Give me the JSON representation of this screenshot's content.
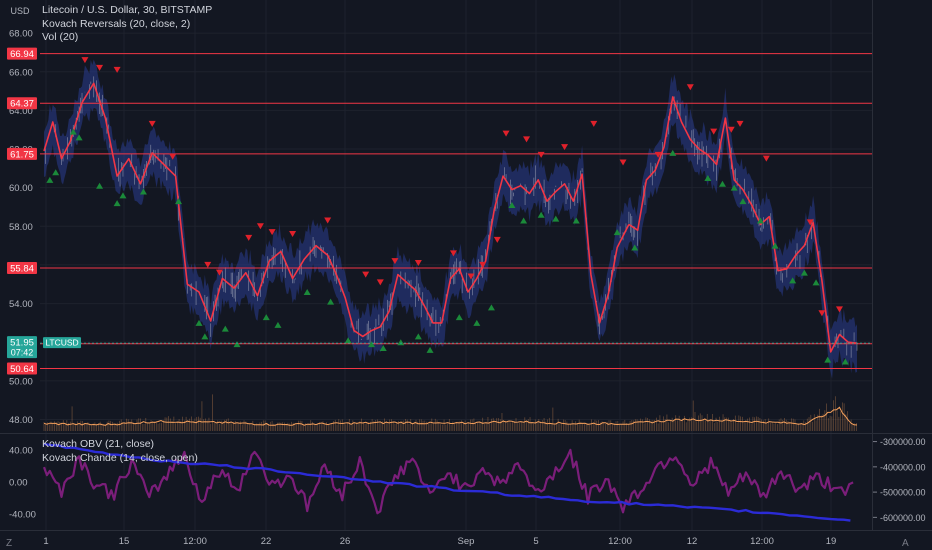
{
  "header": {
    "currency": "USD",
    "symbol_line": "Litecoin / U.S. Dollar, 30, BITSTAMP",
    "indicator1": "Kovach Reversals (20, close, 2)",
    "indicator2": "Vol (20)"
  },
  "lower_pane": {
    "indicator1": "Kovach OBV (21, close)",
    "indicator2": "Kovach Chande (14, close, open)"
  },
  "footer": {
    "left_button": "Z",
    "right_button": "A"
  },
  "colors": {
    "background": "#131722",
    "grid": "#1e222d",
    "level_line": "#f23645",
    "price": "#f23645",
    "band": "#2a3d8f",
    "volume": "#f7a15c",
    "obv": "#2b2bd6",
    "chande": "#7b1e7a",
    "buy_marker": "#1b8a3a",
    "sell_marker": "#e0212b",
    "last_price": "#26a69a"
  },
  "chart_data": [
    {
      "type": "line",
      "title": "Litecoin / U.S. Dollar, 30, BITSTAMP",
      "ylabel": "USD",
      "ylim": [
        47.3,
        69.3
      ],
      "y_ticks": [
        "48.00",
        "50.00",
        "52.00",
        "54.00",
        "56.00",
        "58.00",
        "60.00",
        "62.00",
        "64.00",
        "66.00",
        "68.00"
      ],
      "x_ticks": [
        "1",
        "15",
        "12:00",
        "22",
        "26",
        "Sep",
        "5",
        "12:00",
        "12",
        "12:00",
        "19"
      ],
      "horizontal_levels": [
        "66.94",
        "64.37",
        "61.75",
        "55.84",
        "51.92",
        "50.64"
      ],
      "last_price": {
        "symbol": "LTCUSD",
        "value": "51.95",
        "countdown": "07:42"
      },
      "series": [
        {
          "x": [
            0,
            3,
            6,
            9,
            13,
            17,
            21,
            25,
            29,
            33,
            37,
            41,
            45,
            49,
            53,
            57,
            61,
            65,
            69,
            73,
            77,
            81,
            85,
            89,
            93,
            97,
            100
          ],
          "values": [
            61.9,
            63.4,
            61.5,
            62.4,
            64.4,
            65.4,
            63.6,
            60.6,
            61.5,
            60.2,
            61.8,
            61.2,
            60.6,
            55.0,
            54.6,
            53.1,
            55.3,
            54.8,
            55.6,
            54.4,
            56.2,
            56.7,
            55.3,
            56.3,
            57.0,
            56.5,
            55.5
          ]
        },
        {
          "x": [
            100,
            103,
            106,
            109,
            112,
            115,
            118,
            121,
            124,
            127,
            130,
            133,
            136,
            139,
            142,
            145,
            148,
            151,
            154,
            157,
            160,
            163,
            166,
            169,
            172,
            175,
            178,
            181,
            184,
            187,
            190,
            193,
            196,
            200
          ],
          "values": [
            55.5,
            54.3,
            52.6,
            52.3,
            52.6,
            52.8,
            53.6,
            55.5,
            55.1,
            54.7,
            53.9,
            53.0,
            53.0,
            55.3,
            55.8,
            54.6,
            55.3,
            56.2,
            58.9,
            60.6,
            59.9,
            60.1,
            59.7,
            60.4,
            59.3,
            59.8,
            60.2,
            59.3,
            60.7,
            55.5,
            53.0,
            54.5,
            56.9,
            58.1
          ]
        },
        {
          "x": [
            200,
            203,
            206,
            209,
            212,
            215,
            218,
            221,
            224,
            227,
            230,
            233,
            236,
            239,
            242,
            245,
            248,
            251,
            254,
            257,
            260,
            263,
            266,
            269,
            272,
            275,
            278
          ],
          "values": [
            58.1,
            57.8,
            60.4,
            60.9,
            62.1,
            64.7,
            63.4,
            62.5,
            62.0,
            61.7,
            61.2,
            63.6,
            60.4,
            59.9,
            59.1,
            58.1,
            58.5,
            55.7,
            55.8,
            56.5,
            57.0,
            58.2,
            55.2,
            51.5,
            52.4,
            52.0,
            51.95
          ]
        }
      ],
      "buy_signals": [
        {
          "x": 2,
          "y": 60.4
        },
        {
          "x": 4,
          "y": 60.8
        },
        {
          "x": 10,
          "y": 62.9
        },
        {
          "x": 12,
          "y": 62.6
        },
        {
          "x": 19,
          "y": 60.1
        },
        {
          "x": 25,
          "y": 59.2
        },
        {
          "x": 27,
          "y": 59.6
        },
        {
          "x": 34,
          "y": 59.8
        },
        {
          "x": 46,
          "y": 59.3
        },
        {
          "x": 53,
          "y": 53.0
        },
        {
          "x": 55,
          "y": 52.3
        },
        {
          "x": 62,
          "y": 52.7
        },
        {
          "x": 66,
          "y": 51.9
        },
        {
          "x": 76,
          "y": 53.3
        },
        {
          "x": 80,
          "y": 52.9
        },
        {
          "x": 90,
          "y": 54.6
        },
        {
          "x": 98,
          "y": 54.1
        },
        {
          "x": 104,
          "y": 52.1
        },
        {
          "x": 112,
          "y": 51.9
        },
        {
          "x": 116,
          "y": 51.7
        },
        {
          "x": 122,
          "y": 52.0
        },
        {
          "x": 128,
          "y": 52.3
        },
        {
          "x": 132,
          "y": 51.6
        },
        {
          "x": 142,
          "y": 53.3
        },
        {
          "x": 148,
          "y": 53.0
        },
        {
          "x": 153,
          "y": 53.8
        },
        {
          "x": 160,
          "y": 59.1
        },
        {
          "x": 164,
          "y": 58.3
        },
        {
          "x": 170,
          "y": 58.6
        },
        {
          "x": 175,
          "y": 58.4
        },
        {
          "x": 182,
          "y": 58.3
        },
        {
          "x": 196,
          "y": 57.7
        },
        {
          "x": 202,
          "y": 56.9
        },
        {
          "x": 215,
          "y": 61.8
        },
        {
          "x": 227,
          "y": 60.5
        },
        {
          "x": 232,
          "y": 60.2
        },
        {
          "x": 236,
          "y": 60.0
        },
        {
          "x": 239,
          "y": 59.3
        },
        {
          "x": 245,
          "y": 58.3
        },
        {
          "x": 250,
          "y": 57.0
        },
        {
          "x": 256,
          "y": 55.2
        },
        {
          "x": 260,
          "y": 55.6
        },
        {
          "x": 264,
          "y": 55.1
        },
        {
          "x": 268,
          "y": 51.1
        },
        {
          "x": 274,
          "y": 51.0
        }
      ],
      "sell_signals": [
        {
          "x": 14,
          "y": 66.6
        },
        {
          "x": 19,
          "y": 66.2
        },
        {
          "x": 25,
          "y": 66.1
        },
        {
          "x": 37,
          "y": 63.3
        },
        {
          "x": 44,
          "y": 61.6
        },
        {
          "x": 56,
          "y": 56.0
        },
        {
          "x": 60,
          "y": 55.6
        },
        {
          "x": 70,
          "y": 57.4
        },
        {
          "x": 74,
          "y": 58.0
        },
        {
          "x": 78,
          "y": 57.7
        },
        {
          "x": 85,
          "y": 57.6
        },
        {
          "x": 97,
          "y": 58.3
        },
        {
          "x": 110,
          "y": 55.5
        },
        {
          "x": 115,
          "y": 55.1
        },
        {
          "x": 120,
          "y": 56.2
        },
        {
          "x": 128,
          "y": 56.1
        },
        {
          "x": 140,
          "y": 56.6
        },
        {
          "x": 146,
          "y": 55.4
        },
        {
          "x": 150,
          "y": 56.0
        },
        {
          "x": 155,
          "y": 57.3
        },
        {
          "x": 158,
          "y": 62.8
        },
        {
          "x": 165,
          "y": 62.5
        },
        {
          "x": 170,
          "y": 61.7
        },
        {
          "x": 178,
          "y": 62.1
        },
        {
          "x": 188,
          "y": 63.3
        },
        {
          "x": 198,
          "y": 61.3
        },
        {
          "x": 210,
          "y": 61.7
        },
        {
          "x": 221,
          "y": 65.2
        },
        {
          "x": 229,
          "y": 62.9
        },
        {
          "x": 235,
          "y": 63.0
        },
        {
          "x": 238,
          "y": 63.3
        },
        {
          "x": 247,
          "y": 61.5
        },
        {
          "x": 262,
          "y": 58.2
        },
        {
          "x": 266,
          "y": 53.5
        },
        {
          "x": 272,
          "y": 53.7
        }
      ]
    },
    {
      "type": "line",
      "title": "Kovach OBV (21, close) / Kovach Chande (14, close, open)",
      "ylim_left": [
        -60,
        60
      ],
      "y_ticks_left": [
        "40.00",
        "0.00",
        "-40.00"
      ],
      "ylim_right": [
        -650000,
        -270000
      ],
      "y_ticks_right": [
        "-300000.00",
        "-400000.00",
        "-500000.00",
        "-600000.00"
      ],
      "series": [
        {
          "name": "Kovach OBV (21, close)",
          "x": [
            0,
            20,
            40,
            60,
            80,
            100,
            120,
            140,
            160,
            180,
            200,
            220,
            240,
            260,
            278
          ],
          "values": [
            -310000,
            -345000,
            -375000,
            -395000,
            -415000,
            -440000,
            -465000,
            -490000,
            -510000,
            -530000,
            -545000,
            -560000,
            -575000,
            -595000,
            -615000
          ]
        },
        {
          "name": "Kovach Chande (14, close, open)",
          "x": [
            0,
            6,
            12,
            18,
            24,
            30,
            36,
            42,
            48,
            54,
            60,
            66,
            72,
            78,
            84,
            90,
            96,
            102,
            108,
            114,
            120,
            126,
            132,
            138,
            144,
            150,
            156,
            162,
            168,
            174,
            180,
            186,
            192,
            198,
            204,
            210,
            216,
            222,
            228,
            234,
            240,
            246,
            252,
            258,
            264,
            270,
            278
          ],
          "values": [
            20,
            -10,
            30,
            -5,
            -15,
            25,
            -20,
            10,
            35,
            -25,
            15,
            -10,
            40,
            -5,
            10,
            -30,
            20,
            -15,
            25,
            -35,
            5,
            30,
            -20,
            15,
            -10,
            20,
            -5,
            25,
            -15,
            10,
            35,
            -20,
            5,
            -30,
            -10,
            20,
            35,
            -5,
            25,
            -15,
            10,
            -20,
            15,
            -10,
            5,
            -5,
            -10
          ]
        }
      ]
    },
    {
      "type": "bar",
      "title": "Vol (20)",
      "x": [
        0,
        20,
        40,
        60,
        80,
        100,
        120,
        140,
        160,
        180,
        200,
        220,
        240,
        260,
        272,
        276,
        278
      ],
      "values": [
        2,
        1.5,
        3,
        2.5,
        1.5,
        2,
        2.5,
        2,
        3,
        2,
        2,
        4,
        3,
        2,
        9,
        2,
        1
      ]
    }
  ]
}
